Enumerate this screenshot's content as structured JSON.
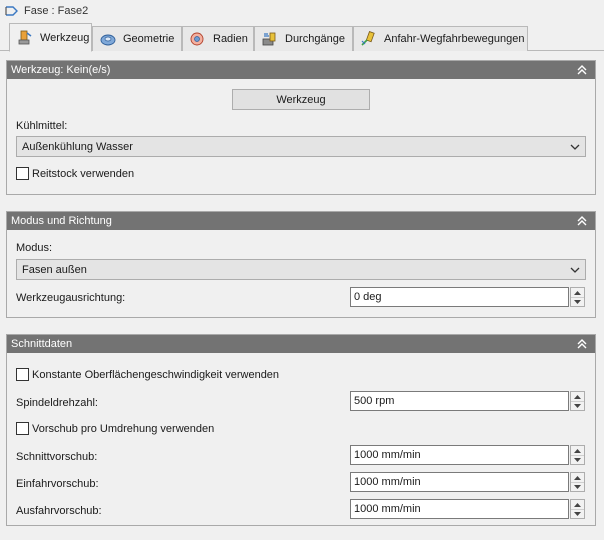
{
  "window": {
    "title": "Fase : Fase2",
    "icon": "fase-icon"
  },
  "tabs": [
    {
      "label": "Werkzeug",
      "icon": "tool-icon",
      "active": true
    },
    {
      "label": "Geometrie",
      "icon": "geometry-icon",
      "active": false
    },
    {
      "label": "Radien",
      "icon": "radii-icon",
      "active": false
    },
    {
      "label": "Durchgänge",
      "icon": "passes-icon",
      "active": false
    },
    {
      "label": "Anfahr-Wegfahrbewegungen",
      "icon": "linking-icon",
      "active": false
    }
  ],
  "werkzeug_panel": {
    "title": "Werkzeug: Kein(e/s)",
    "tool_button": "Werkzeug",
    "coolant_label": "Kühlmittel:",
    "coolant_value": "Außenkühlung Wasser",
    "tailstock_label": "Reitstock verwenden",
    "tailstock_checked": false
  },
  "modus_panel": {
    "title": "Modus und Richtung",
    "mode_label": "Modus:",
    "mode_value": "Fasen außen",
    "orientation_label": "Werkzeugausrichtung:",
    "orientation_value": "0 deg"
  },
  "schnitt_panel": {
    "title": "Schnittdaten",
    "css_label": "Konstante Oberflächengeschwindigkeit verwenden",
    "css_checked": false,
    "spindle_label": "Spindeldrehzahl:",
    "spindle_value": "500 rpm",
    "feed_per_rev_label": "Vorschub pro Umdrehung verwenden",
    "feed_per_rev_checked": false,
    "cutting_feed_label": "Schnittvorschub:",
    "cutting_feed_value": "1000 mm/min",
    "lead_in_feed_label": "Einfahrvorschub:",
    "lead_in_feed_value": "1000 mm/min",
    "lead_out_feed_label": "Ausfahrvorschub:",
    "lead_out_feed_value": "1000 mm/min"
  },
  "colors": {
    "panel_header": "#737373",
    "background": "#f0f0f0",
    "accent_orange": "#e8a13a",
    "accent_blue": "#3a78c2"
  }
}
